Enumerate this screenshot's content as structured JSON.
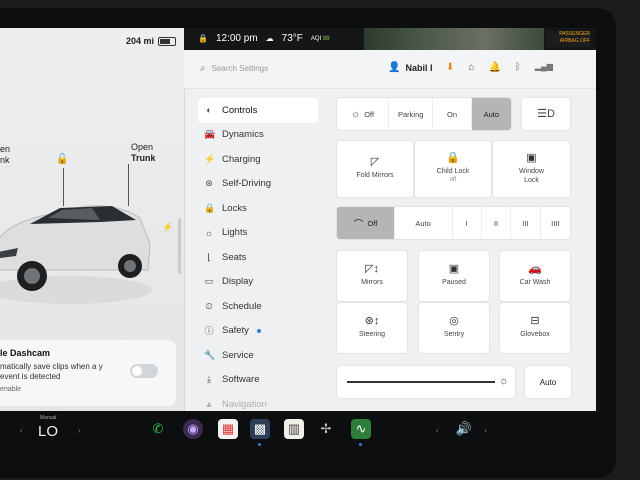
{
  "left_panel": {
    "range": "204 mi",
    "front_label_line1": "en",
    "front_label_line2": "nk",
    "trunk_line1": "Open",
    "trunk_line2": "Trunk",
    "dashcam": {
      "title": "le Dashcam",
      "desc": "matically save clips when a y event is detected",
      "enable": "enable"
    }
  },
  "statusbar": {
    "time": "12:00 pm",
    "temp": "73°F",
    "aqi": "AQI",
    "aqi_value": "88",
    "airbag_line1": "PASSENGER",
    "airbag_line2": "AIRBAG OFF"
  },
  "header": {
    "search_placeholder": "Search Settings",
    "user": "Nabil I"
  },
  "sidebar": {
    "items": [
      {
        "label": "Controls"
      },
      {
        "label": "Dynamics"
      },
      {
        "label": "Charging"
      },
      {
        "label": "Self-Driving"
      },
      {
        "label": "Locks"
      },
      {
        "label": "Lights"
      },
      {
        "label": "Seats"
      },
      {
        "label": "Display"
      },
      {
        "label": "Schedule"
      },
      {
        "label": "Safety"
      },
      {
        "label": "Service"
      },
      {
        "label": "Software"
      },
      {
        "label": "Navigation"
      }
    ]
  },
  "controls": {
    "lights": [
      "Off",
      "Parking",
      "On",
      "Auto"
    ],
    "fold_mirrors": "Fold Mirrors",
    "child_lock": "Child Lock",
    "child_lock_state": "off",
    "window_lock_line1": "Window",
    "window_lock_line2": "Lock",
    "wipers": [
      "Off",
      "Auto",
      "I",
      "II",
      "III",
      "IIII"
    ],
    "mirrors": "Mirrors",
    "paused": "Paused",
    "car_wash": "Car Wash",
    "steering": "Steering",
    "sentry": "Sentry",
    "glovebox": "Glovebox",
    "brightness_auto": "Auto"
  },
  "dock": {
    "manual": "Manual",
    "lo": "LO"
  }
}
